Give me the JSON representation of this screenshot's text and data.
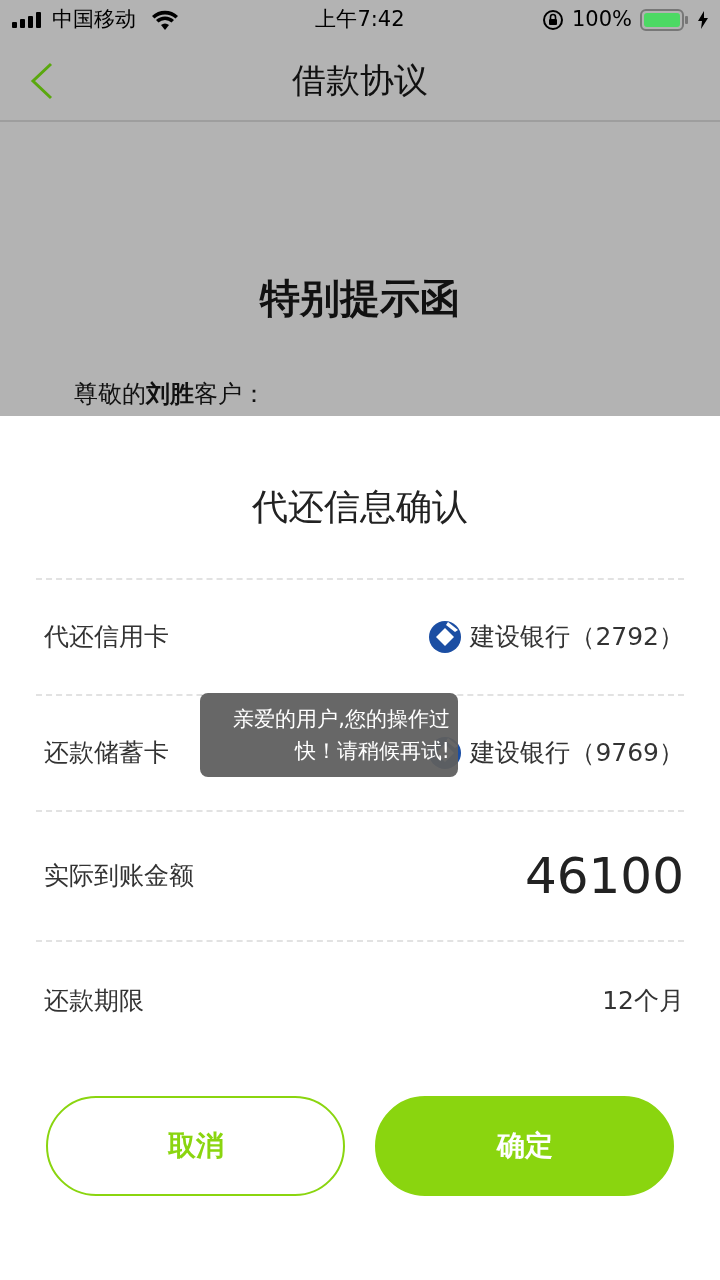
{
  "status_bar": {
    "carrier": "中国移动",
    "time": "上午7:42",
    "battery": "100%"
  },
  "nav": {
    "title": "借款协议"
  },
  "document": {
    "heading": "特别提示函",
    "greeting": "尊敬的**刘胜**客户："
  },
  "sheet": {
    "title": "代还信息确认",
    "rows": [
      {
        "kind": "bank",
        "label": "代还信用卡",
        "value": "建设银行（2792）"
      },
      {
        "kind": "bank",
        "label": "还款储蓄卡",
        "value": "建设银行（9769）"
      },
      {
        "kind": "amount",
        "label": "实际到账金额",
        "value": "46100"
      },
      {
        "kind": "text",
        "label": "还款期限",
        "value": "12个月"
      }
    ],
    "buttons": [
      {
        "kind": "outline",
        "label": "取消"
      },
      {
        "kind": "solid",
        "label": "确定"
      }
    ]
  },
  "toast": {
    "text": "亲爱的用户,您的操作过快！请稍候再试!"
  }
}
